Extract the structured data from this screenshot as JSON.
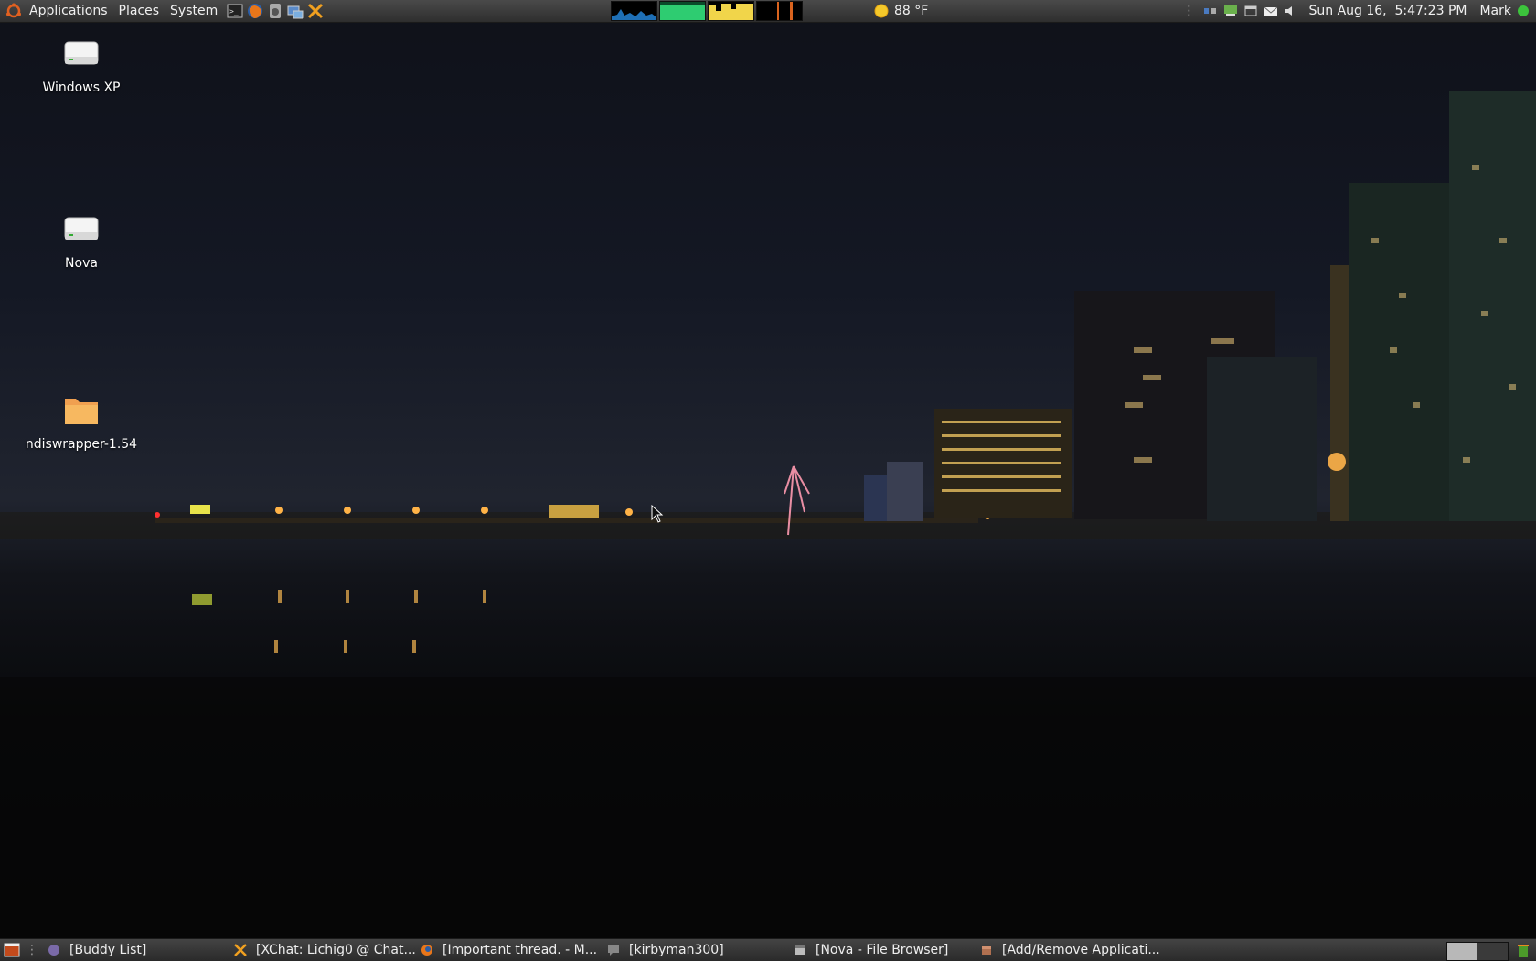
{
  "top_panel": {
    "menus": [
      "Applications",
      "Places",
      "System"
    ],
    "launchers": [
      "terminal-icon",
      "firefox-icon",
      "disk-utility-icon",
      "network-icon",
      "xchat-icon"
    ],
    "monitors": [
      "cpu-monitor",
      "memory-monitor",
      "network-monitor",
      "load-monitor"
    ],
    "weather": {
      "icon": "sun-icon",
      "temperature": "88 °F"
    },
    "tray_icons": [
      "network-tray-icon",
      "chat-tray-icon",
      "window-tray-icon",
      "mail-icon",
      "volume-icon"
    ],
    "clock": "Sun Aug 16,  5:47:23 PM",
    "user": "Mark",
    "colors": {
      "cpu": "#1e6fb5",
      "memory": "#2ecc71",
      "network": "#f1d54a",
      "load": "#d9631e"
    }
  },
  "desktop": {
    "icons": [
      {
        "label": "Windows XP",
        "icon": "drive-icon"
      },
      {
        "label": "Nova",
        "icon": "drive-icon"
      },
      {
        "label": "ndiswrapper-1.54",
        "icon": "folder-icon"
      }
    ]
  },
  "taskbar": {
    "tasks": [
      {
        "label": "[Buddy List]",
        "icon": "pidgin-icon"
      },
      {
        "label": "[XChat: Lichig0 @ Chat...",
        "icon": "xchat-icon"
      },
      {
        "label": "[Important thread. - M...",
        "icon": "firefox-icon"
      },
      {
        "label": "[kirbyman300]",
        "icon": "chat-icon"
      },
      {
        "label": "[Nova - File Browser]",
        "icon": "file-browser-icon"
      },
      {
        "label": "[Add/Remove Applicati...",
        "icon": "package-icon"
      }
    ],
    "workspaces": 2
  }
}
